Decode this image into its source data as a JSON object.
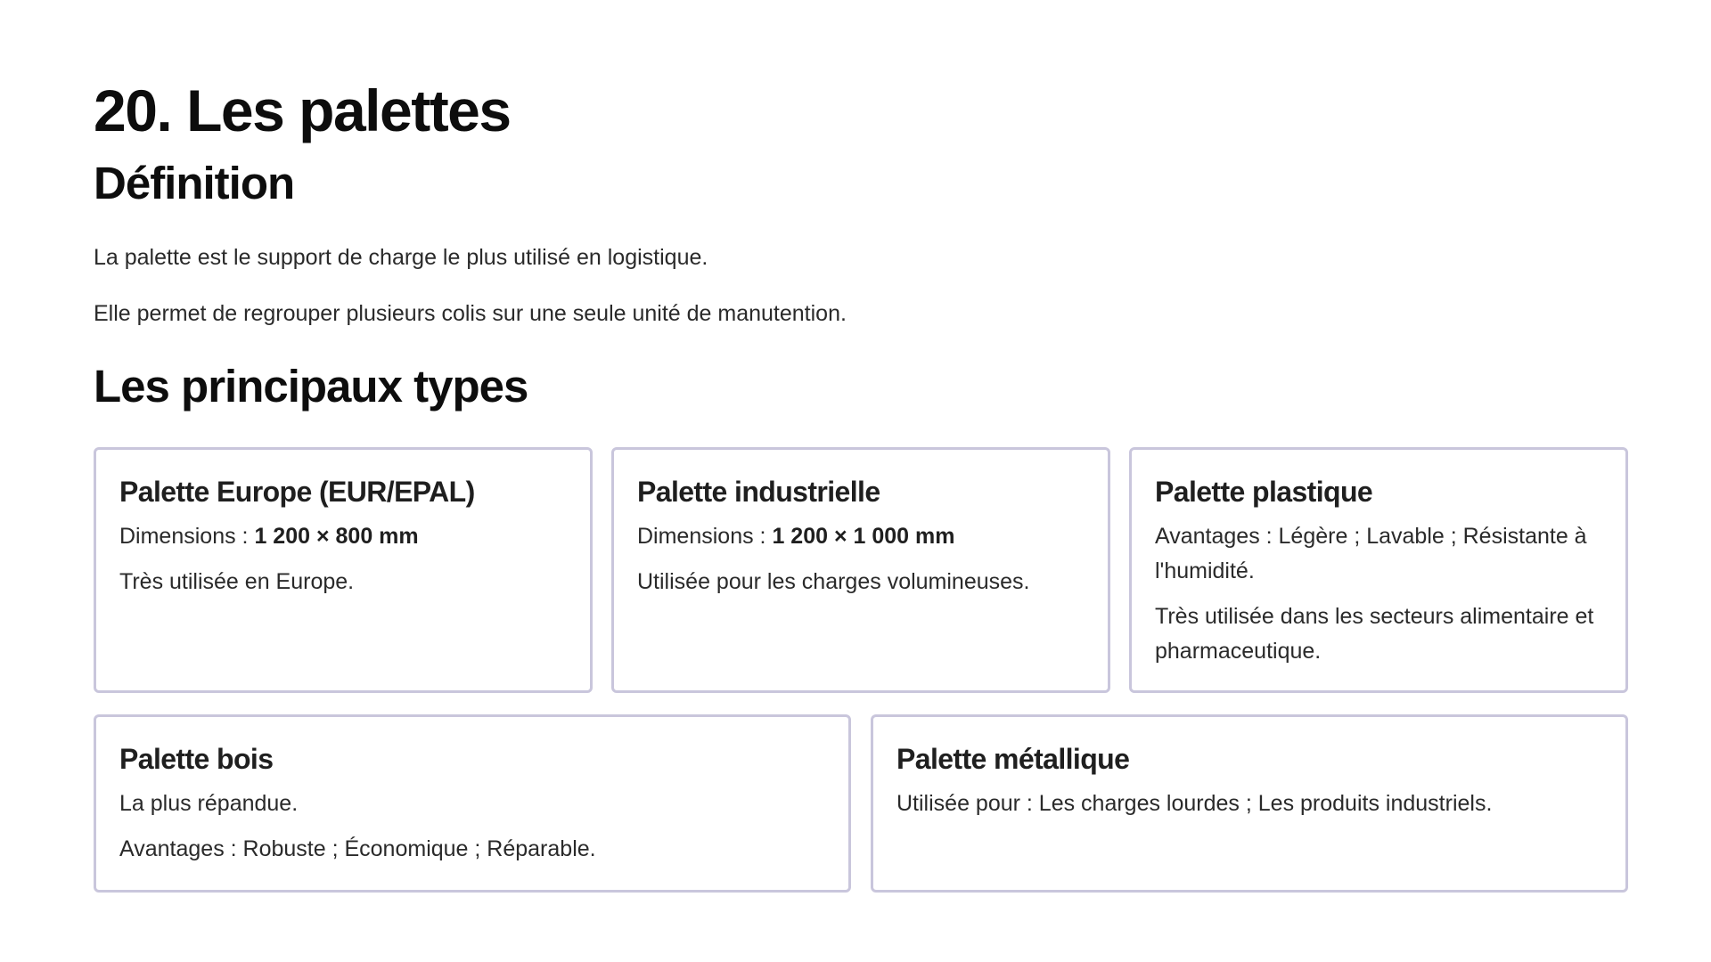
{
  "page": {
    "title": "20. Les palettes",
    "definition_title": "Définition",
    "definition_paragraphs": [
      "La palette est le support de charge le plus utilisé en logistique.",
      "Elle permet de regrouper plusieurs colis sur une seule unité de manutention."
    ],
    "types_title": "Les principaux types"
  },
  "cards": [
    {
      "title": "Palette Europe (EUR/EPAL)",
      "dim_label": "Dimensions : ",
      "dim_value": "1 200 × 800 mm",
      "note": "Très utilisée en Europe."
    },
    {
      "title": "Palette industrielle",
      "dim_label": "Dimensions : ",
      "dim_value": "1 200 × 1 000 mm",
      "note": "Utilisée pour les charges volumineuses."
    },
    {
      "title": "Palette plastique",
      "advantages": "Avantages : Légère ; Lavable ; Résistante à l'humidité.",
      "note": "Très utilisée dans les secteurs alimentaire et pharmaceutique."
    },
    {
      "title": "Palette bois",
      "line1": "La plus répandue.",
      "advantages": "Avantages : Robuste ; Économique ; Réparable."
    },
    {
      "title": "Palette métallique",
      "usage": "Utilisée pour : Les charges lourdes ; Les produits industriels."
    }
  ],
  "colors": {
    "card_border": "#c9c6dc",
    "heading": "#0d0d0d",
    "body_text": "#2a2a2a"
  }
}
